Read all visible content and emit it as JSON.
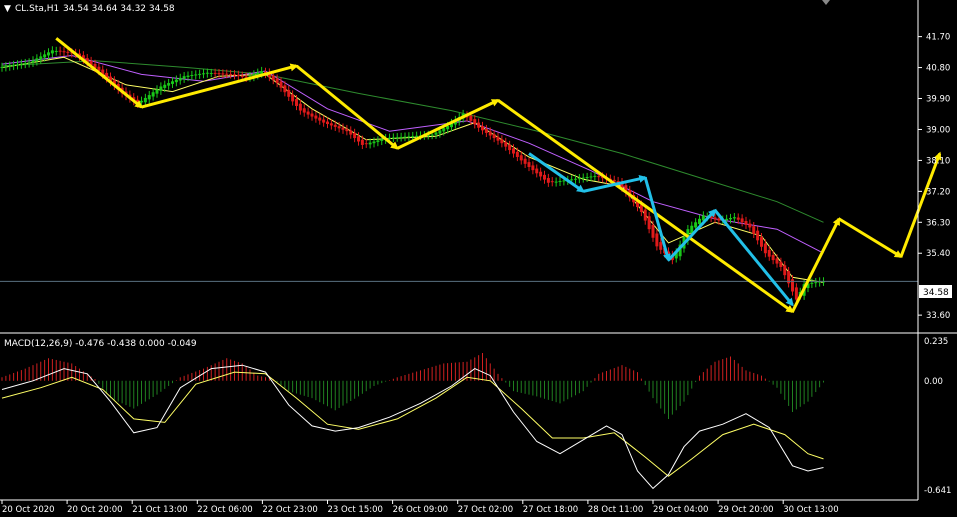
{
  "header": {
    "symbol_label": "CL.Sta,H1",
    "ohlc": "34.54 34.64 34.32 34.58"
  },
  "macd_header": "MACD(12,26,9) -0.476 -0.438 0.000 -0.049",
  "price_badge": "34.58",
  "colors": {
    "background": "#000000",
    "bull": "#19c819",
    "bear": "#e01a1a",
    "ma_fast": "#ffff66",
    "ma_mid": "#c060ff",
    "ma_slow": "#2e8b2e",
    "arrow_yellow": "#ffeb00",
    "arrow_cyan": "#22c0e8",
    "macd_signal": "#ffff66",
    "macd_line": "#ffffff",
    "hist_pos": "#d02020",
    "hist_neg": "#208020"
  },
  "chart_data": [
    {
      "type": "candlestick",
      "symbol": "CL.Sta",
      "timeframe": "H1",
      "y_ticks": [
        "41.70",
        "40.80",
        "39.90",
        "39.00",
        "38.10",
        "37.20",
        "36.30",
        "35.40",
        "33.60"
      ],
      "x_ticks": [
        "20 Oct 2020",
        "20 Oct 20:00",
        "21 Oct 13:00",
        "22 Oct 06:00",
        "22 Oct 23:00",
        "23 Oct 15:00",
        "26 Oct 09:00",
        "27 Oct 02:00",
        "27 Oct 18:00",
        "28 Oct 11:00",
        "29 Oct 04:00",
        "29 Oct 20:00",
        "30 Oct 13:00"
      ],
      "ylim": [
        33.4,
        42.3
      ],
      "last_price": 34.58,
      "price_path": [
        [
          0,
          40.8
        ],
        [
          4,
          40.95
        ],
        [
          7,
          41.3
        ],
        [
          10,
          41.2
        ],
        [
          13,
          40.7
        ],
        [
          16,
          40.05
        ],
        [
          18,
          39.75
        ],
        [
          21,
          40.25
        ],
        [
          24,
          40.55
        ],
        [
          27,
          40.65
        ],
        [
          30,
          40.6
        ],
        [
          32,
          40.5
        ],
        [
          34,
          40.7
        ],
        [
          36,
          40.35
        ],
        [
          39,
          39.55
        ],
        [
          42,
          39.2
        ],
        [
          45,
          38.95
        ],
        [
          47,
          38.55
        ],
        [
          50,
          38.75
        ],
        [
          53,
          38.8
        ],
        [
          56,
          38.85
        ],
        [
          58,
          39.1
        ],
        [
          60,
          39.45
        ],
        [
          62,
          39.05
        ],
        [
          65,
          38.6
        ],
        [
          68,
          38.0
        ],
        [
          71,
          37.45
        ],
        [
          74,
          37.55
        ],
        [
          77,
          37.65
        ],
        [
          80,
          37.45
        ],
        [
          83,
          36.6
        ],
        [
          85,
          35.6
        ],
        [
          87,
          35.2
        ],
        [
          89,
          36.1
        ],
        [
          91,
          36.5
        ],
        [
          93,
          36.35
        ],
        [
          95,
          36.45
        ],
        [
          97,
          36.15
        ],
        [
          99,
          35.4
        ],
        [
          101,
          35.0
        ],
        [
          103,
          34.05
        ],
        [
          104,
          34.5
        ],
        [
          106,
          34.58
        ]
      ],
      "ma_fast_path": [
        [
          0,
          40.8
        ],
        [
          8,
          41.1
        ],
        [
          16,
          40.3
        ],
        [
          22,
          40.1
        ],
        [
          28,
          40.55
        ],
        [
          34,
          40.6
        ],
        [
          40,
          39.6
        ],
        [
          47,
          38.7
        ],
        [
          56,
          38.8
        ],
        [
          61,
          39.2
        ],
        [
          68,
          38.2
        ],
        [
          75,
          37.55
        ],
        [
          80,
          37.35
        ],
        [
          86,
          35.7
        ],
        [
          92,
          36.3
        ],
        [
          98,
          35.9
        ],
        [
          102,
          34.7
        ],
        [
          106,
          34.55
        ]
      ],
      "ma_mid_path": [
        [
          0,
          40.9
        ],
        [
          9,
          41.15
        ],
        [
          18,
          40.6
        ],
        [
          26,
          40.4
        ],
        [
          34,
          40.7
        ],
        [
          42,
          39.6
        ],
        [
          50,
          38.95
        ],
        [
          60,
          39.25
        ],
        [
          68,
          38.6
        ],
        [
          76,
          37.8
        ],
        [
          84,
          36.9
        ],
        [
          92,
          36.4
        ],
        [
          100,
          36.1
        ],
        [
          106,
          35.4
        ]
      ],
      "ma_slow_path": [
        [
          0,
          40.85
        ],
        [
          12,
          41.0
        ],
        [
          24,
          40.8
        ],
        [
          34,
          40.6
        ],
        [
          46,
          40.05
        ],
        [
          58,
          39.55
        ],
        [
          70,
          38.9
        ],
        [
          80,
          38.3
        ],
        [
          90,
          37.6
        ],
        [
          100,
          36.9
        ],
        [
          106,
          36.3
        ]
      ],
      "yellow_arrows": [
        [
          [
            7,
            41.65
          ],
          [
            18,
            39.65
          ]
        ],
        [
          [
            18,
            39.65
          ],
          [
            38,
            40.85
          ]
        ],
        [
          [
            38,
            40.85
          ],
          [
            51,
            38.45
          ]
        ],
        [
          [
            51,
            38.45
          ],
          [
            64,
            39.85
          ]
        ],
        [
          [
            64,
            39.85
          ],
          [
            102,
            33.7
          ]
        ],
        [
          [
            102,
            33.7
          ],
          [
            108,
            36.4
          ]
        ],
        [
          [
            108,
            36.4
          ],
          [
            116,
            35.3
          ]
        ],
        [
          [
            116,
            35.3
          ],
          [
            121,
            38.3
          ]
        ]
      ],
      "cyan_arrows": [
        [
          [
            68,
            38.3
          ],
          [
            75,
            37.2
          ]
        ],
        [
          [
            75,
            37.2
          ],
          [
            83,
            37.6
          ]
        ],
        [
          [
            83,
            37.6
          ],
          [
            86,
            35.2
          ]
        ],
        [
          [
            86,
            35.2
          ],
          [
            92,
            36.65
          ]
        ],
        [
          [
            92,
            36.65
          ],
          [
            102,
            33.9
          ]
        ]
      ]
    },
    {
      "type": "macd",
      "params": "12,26,9",
      "y_ticks": [
        "0.235",
        "0.00",
        "-0.641"
      ],
      "ylim": [
        -0.641,
        0.235
      ],
      "histogram": [
        [
          0,
          0.02
        ],
        [
          3,
          0.07
        ],
        [
          6,
          0.13
        ],
        [
          9,
          0.1
        ],
        [
          12,
          0.01
        ],
        [
          14,
          -0.1
        ],
        [
          17,
          -0.16
        ],
        [
          20,
          -0.08
        ],
        [
          23,
          0.02
        ],
        [
          26,
          0.07
        ],
        [
          29,
          0.13
        ],
        [
          31,
          0.1
        ],
        [
          33,
          0.03
        ],
        [
          35,
          0.01
        ],
        [
          37,
          -0.06
        ],
        [
          40,
          -0.1
        ],
        [
          43,
          -0.17
        ],
        [
          46,
          -0.09
        ],
        [
          48,
          -0.03
        ],
        [
          51,
          0.02
        ],
        [
          54,
          0.06
        ],
        [
          57,
          0.1
        ],
        [
          60,
          0.11
        ],
        [
          62,
          0.16
        ],
        [
          64,
          0.04
        ],
        [
          66,
          -0.06
        ],
        [
          69,
          -0.09
        ],
        [
          72,
          -0.13
        ],
        [
          75,
          -0.06
        ],
        [
          77,
          0.04
        ],
        [
          80,
          0.09
        ],
        [
          82,
          0.05
        ],
        [
          84,
          -0.1
        ],
        [
          86,
          -0.22
        ],
        [
          88,
          -0.12
        ],
        [
          90,
          0.03
        ],
        [
          92,
          0.11
        ],
        [
          94,
          0.14
        ],
        [
          96,
          0.06
        ],
        [
          98,
          0.03
        ],
        [
          100,
          -0.04
        ],
        [
          102,
          -0.18
        ],
        [
          104,
          -0.12
        ],
        [
          106,
          -0.01
        ]
      ],
      "macd_line": [
        [
          0,
          -0.05
        ],
        [
          4,
          0.0
        ],
        [
          8,
          0.07
        ],
        [
          11,
          0.04
        ],
        [
          14,
          -0.12
        ],
        [
          17,
          -0.3
        ],
        [
          20,
          -0.27
        ],
        [
          23,
          -0.04
        ],
        [
          27,
          0.07
        ],
        [
          31,
          0.09
        ],
        [
          34,
          0.05
        ],
        [
          37,
          -0.14
        ],
        [
          40,
          -0.26
        ],
        [
          43,
          -0.29
        ],
        [
          46,
          -0.27
        ],
        [
          50,
          -0.21
        ],
        [
          54,
          -0.13
        ],
        [
          58,
          -0.03
        ],
        [
          61,
          0.07
        ],
        [
          63,
          0.03
        ],
        [
          66,
          -0.18
        ],
        [
          69,
          -0.35
        ],
        [
          72,
          -0.42
        ],
        [
          75,
          -0.34
        ],
        [
          78,
          -0.26
        ],
        [
          80,
          -0.31
        ],
        [
          82,
          -0.52
        ],
        [
          84,
          -0.62
        ],
        [
          86,
          -0.54
        ],
        [
          88,
          -0.38
        ],
        [
          90,
          -0.29
        ],
        [
          93,
          -0.25
        ],
        [
          96,
          -0.19
        ],
        [
          99,
          -0.27
        ],
        [
          102,
          -0.49
        ],
        [
          104,
          -0.52
        ],
        [
          106,
          -0.5
        ]
      ],
      "signal_line": [
        [
          0,
          -0.1
        ],
        [
          5,
          -0.04
        ],
        [
          9,
          0.02
        ],
        [
          13,
          -0.05
        ],
        [
          17,
          -0.22
        ],
        [
          21,
          -0.24
        ],
        [
          25,
          -0.02
        ],
        [
          30,
          0.05
        ],
        [
          34,
          0.04
        ],
        [
          38,
          -0.1
        ],
        [
          42,
          -0.25
        ],
        [
          46,
          -0.28
        ],
        [
          51,
          -0.22
        ],
        [
          56,
          -0.1
        ],
        [
          60,
          0.02
        ],
        [
          63,
          0.0
        ],
        [
          67,
          -0.16
        ],
        [
          71,
          -0.33
        ],
        [
          75,
          -0.33
        ],
        [
          79,
          -0.3
        ],
        [
          83,
          -0.44
        ],
        [
          86,
          -0.55
        ],
        [
          89,
          -0.45
        ],
        [
          93,
          -0.31
        ],
        [
          97,
          -0.25
        ],
        [
          101,
          -0.31
        ],
        [
          104,
          -0.42
        ],
        [
          106,
          -0.45
        ]
      ]
    }
  ]
}
